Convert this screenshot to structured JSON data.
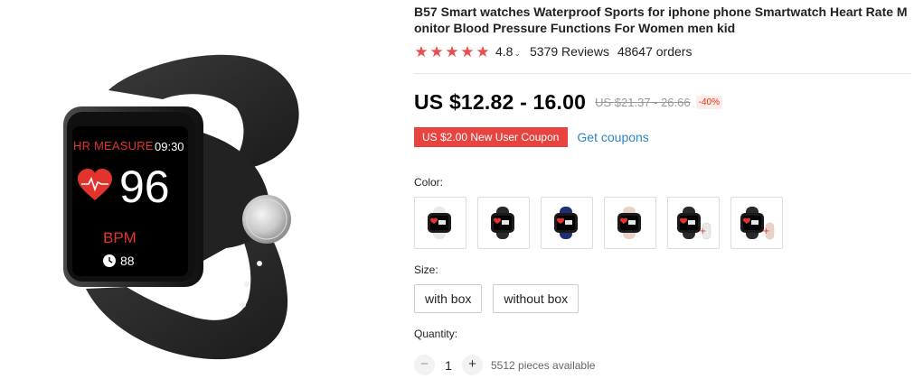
{
  "product": {
    "title": "B57 Smart watches Waterproof Sports for iphone phone Smartwatch Heart Rate Monitor Blood Pressure Functions For Women men kid",
    "image_alt": "black smart watch",
    "screen": {
      "label": "HR MEASURE",
      "time": "09:30",
      "value": "96",
      "unit": "BPM",
      "steps": "88"
    }
  },
  "rating": {
    "stars": 5,
    "value": "4.8",
    "reviews": "5379 Reviews",
    "orders": "48647 orders",
    "star_color": "#e84d4d"
  },
  "price": {
    "current": "US $12.82 - 16.00",
    "original": "US $21.37 - 26.66",
    "discount": "-40%"
  },
  "coupon": {
    "tag": "US $2.00 New User Coupon",
    "link": "Get coupons",
    "tag_color": "#e8443f",
    "link_color": "#2b86c5"
  },
  "color": {
    "label": "Color:",
    "options": [
      {
        "name": "white",
        "band": "#e9e9e9",
        "extra": null
      },
      {
        "name": "black",
        "band": "#2a2a2a",
        "extra": null
      },
      {
        "name": "blue",
        "band": "#1f2f73",
        "extra": null
      },
      {
        "name": "pink",
        "band": "#ead1c8",
        "extra": null
      },
      {
        "name": "black+white",
        "band": "#2a2a2a",
        "extra": "#e9e9e9"
      },
      {
        "name": "black+pink",
        "band": "#2a2a2a",
        "extra": "#ead1c8"
      }
    ]
  },
  "size": {
    "label": "Size:",
    "options": [
      "with box",
      "without box"
    ]
  },
  "quantity": {
    "label": "Quantity:",
    "value": "1",
    "minus": "−",
    "plus": "+",
    "available": "5512 pieces available"
  }
}
